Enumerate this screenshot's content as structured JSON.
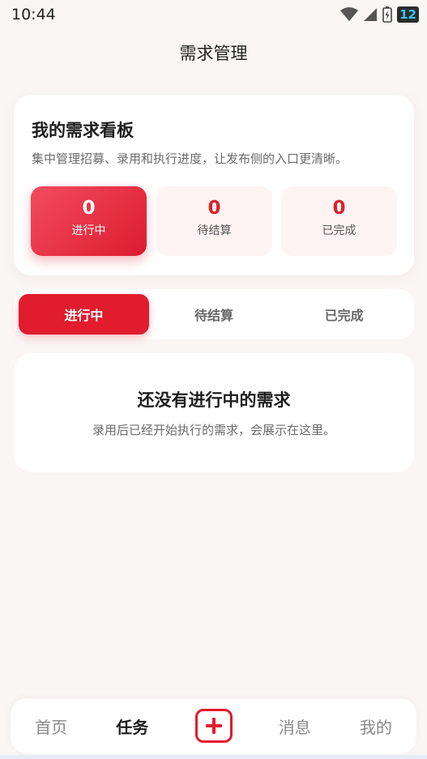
{
  "status_bar": {
    "time": "10:44",
    "battery_level": "12",
    "icons": [
      "wifi-icon",
      "signal-icon",
      "battery-charging-icon"
    ]
  },
  "header": {
    "title": "需求管理"
  },
  "board": {
    "title": "我的需求看板",
    "description": "集中管理招募、录用和执行进度，让发布侧的入口更清晰。",
    "stats": [
      {
        "count": "0",
        "label": "进行中",
        "active": true
      },
      {
        "count": "0",
        "label": "待结算",
        "active": false
      },
      {
        "count": "0",
        "label": "已完成",
        "active": false
      }
    ]
  },
  "tabs": [
    {
      "label": "进行中",
      "active": true
    },
    {
      "label": "待结算",
      "active": false
    },
    {
      "label": "已完成",
      "active": false
    }
  ],
  "empty_state": {
    "title": "还没有进行中的需求",
    "description": "录用后已经开始执行的需求，会展示在这里。"
  },
  "bottom_nav": {
    "items": [
      {
        "label": "首页",
        "active": false
      },
      {
        "label": "任务",
        "active": true
      },
      {
        "label": "消息",
        "active": false
      },
      {
        "label": "我的",
        "active": false
      }
    ],
    "add_icon": "plus-icon"
  },
  "colors": {
    "accent": "#e01c2d",
    "background": "#faf6f5",
    "card": "#ffffff",
    "stat_inactive_bg": "#fff3f3"
  }
}
